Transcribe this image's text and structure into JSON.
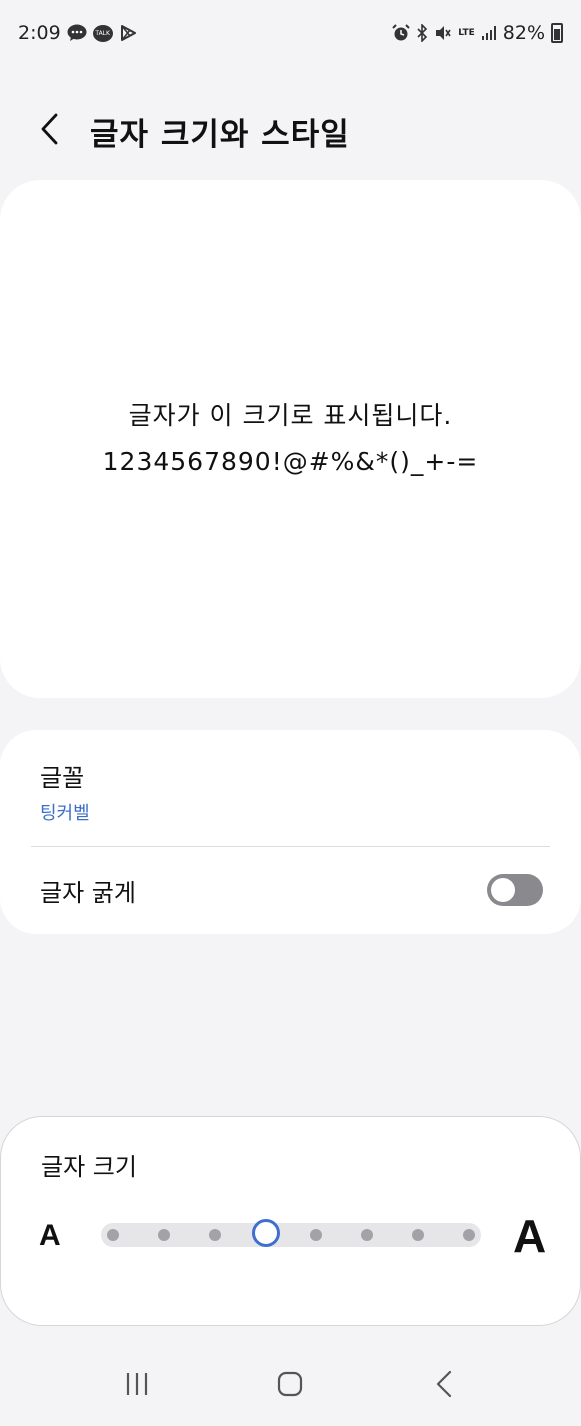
{
  "status_bar": {
    "time": "2:09",
    "kakao_talk_label": "TALK",
    "lte_label": "LTE",
    "battery": "82%",
    "icons": [
      "message-icon",
      "kakaotalk-icon",
      "play-store-icon",
      "alarm-icon",
      "bluetooth-icon",
      "mute-icon",
      "lte-icon",
      "signal-icon",
      "battery-icon"
    ]
  },
  "header": {
    "title": "글자 크기와 스타일",
    "back_icon": "chevron-left-icon"
  },
  "preview": {
    "line1": "글자가 이 크기로 표시됩니다.",
    "line2": "1234567890!@#%&*()_+-="
  },
  "font_settings": {
    "font_label": "글꼴",
    "font_value": "팅커벨",
    "bold_label": "글자 굵게",
    "bold_enabled": false
  },
  "font_size": {
    "label": "글자 크기",
    "small_glyph": "A",
    "large_glyph": "A",
    "steps": 8,
    "selected_step": 4
  },
  "nav_bar": {
    "icons": [
      "recent-apps-icon",
      "home-icon",
      "back-icon"
    ]
  },
  "colors": {
    "accent": "#3e6fd0",
    "font_value": "#3e6fc4",
    "background": "#f4f4f6",
    "card": "#ffffff",
    "toggle_off": "#8a8a8e"
  }
}
